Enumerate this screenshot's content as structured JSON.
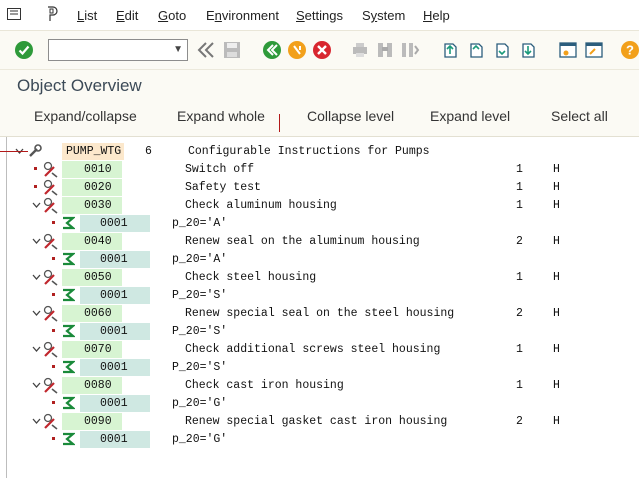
{
  "menu": {
    "items": [
      {
        "pre": "",
        "u": "L",
        "post": "ist"
      },
      {
        "pre": "",
        "u": "E",
        "post": "dit"
      },
      {
        "pre": "",
        "u": "G",
        "post": "oto"
      },
      {
        "pre": "E",
        "u": "n",
        "post": "vironment"
      },
      {
        "pre": "",
        "u": "S",
        "post": "ettings"
      },
      {
        "pre": "S",
        "u": "y",
        "post": "stem"
      },
      {
        "pre": "",
        "u": "H",
        "post": "elp"
      }
    ]
  },
  "toolbar": {
    "command_value": ""
  },
  "page": {
    "title": "Object Overview"
  },
  "appbar": {
    "buttons": [
      "Expand/collapse",
      "Expand whole",
      "Collapse level",
      "Expand level",
      "Select all"
    ]
  },
  "tree": {
    "root": {
      "name": "PUMP_WTG",
      "count": "6",
      "desc": "Configurable Instructions for Pumps"
    },
    "rows": [
      {
        "kind": "op",
        "num": "0010",
        "desc": "Switch off",
        "qty": "1",
        "unit": "H",
        "expanded": false
      },
      {
        "kind": "op",
        "num": "0020",
        "desc": "Safety test",
        "qty": "1",
        "unit": "H",
        "expanded": false
      },
      {
        "kind": "op",
        "num": "0030",
        "desc": "Check aluminum housing",
        "qty": "1",
        "unit": "H",
        "expanded": true
      },
      {
        "kind": "dep",
        "num": "0001",
        "desc": "p_20='A'"
      },
      {
        "kind": "op",
        "num": "0040",
        "desc": "Renew seal on the aluminum housing",
        "qty": "2",
        "unit": "H",
        "expanded": true
      },
      {
        "kind": "dep",
        "num": "0001",
        "desc": "p_20='A'"
      },
      {
        "kind": "op",
        "num": "0050",
        "desc": "Check steel housing",
        "qty": "1",
        "unit": "H",
        "expanded": true
      },
      {
        "kind": "dep",
        "num": "0001",
        "desc": "P_20='S'"
      },
      {
        "kind": "op",
        "num": "0060",
        "desc": "Renew special seal on the steel housing",
        "qty": "2",
        "unit": "H",
        "expanded": true
      },
      {
        "kind": "dep",
        "num": "0001",
        "desc": "P_20='S'"
      },
      {
        "kind": "op",
        "num": "0070",
        "desc": "Check additional screws steel housing",
        "qty": "1",
        "unit": "H",
        "expanded": true
      },
      {
        "kind": "dep",
        "num": "0001",
        "desc": "P_20='S'"
      },
      {
        "kind": "op",
        "num": "0080",
        "desc": "Check cast iron housing",
        "qty": "1",
        "unit": "H",
        "expanded": true
      },
      {
        "kind": "dep",
        "num": "0001",
        "desc": "p_20='G'"
      },
      {
        "kind": "op",
        "num": "0090",
        "desc": "Renew special gasket cast iron housing",
        "qty": "2",
        "unit": "H",
        "expanded": true
      },
      {
        "kind": "dep",
        "num": "0001",
        "desc": "p_20='G'"
      }
    ]
  }
}
